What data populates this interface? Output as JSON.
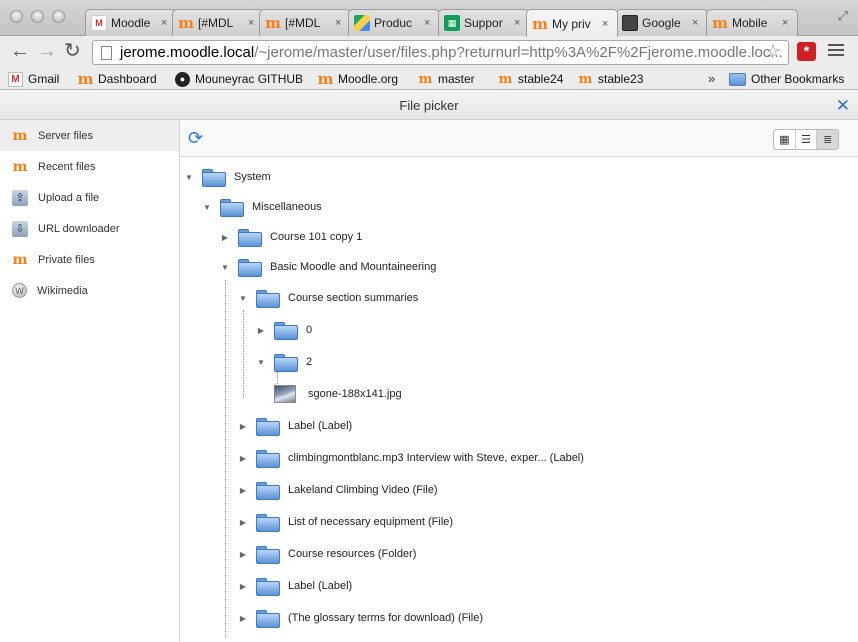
{
  "browser": {
    "tabs": [
      {
        "title": "Moodle",
        "favicon": "gmail-icon",
        "close": "×",
        "fav_text": "M"
      },
      {
        "title": "[#MDL",
        "favicon": "moodle-icon",
        "close": "×",
        "fav_text": "m"
      },
      {
        "title": "[#MDL",
        "favicon": "moodle-icon",
        "close": "×",
        "fav_text": "m"
      },
      {
        "title": "Produc",
        "favicon": "drive-icon",
        "close": "×",
        "fav_text": ""
      },
      {
        "title": "Suppor",
        "favicon": "sheets-icon",
        "close": "×",
        "fav_text": "▦"
      },
      {
        "title": "My priv",
        "favicon": "moodle-icon",
        "close": "×",
        "fav_text": "m"
      },
      {
        "title": "Google",
        "favicon": "google-icon",
        "close": "×",
        "fav_text": ""
      },
      {
        "title": "Mobile",
        "favicon": "moodle-icon",
        "close": "×",
        "fav_text": "m"
      }
    ],
    "url_host": "jerome.moodle.local",
    "url_path": "/~jerome/master/user/files.php?returnurl=http%3A%2F%2Fjerome.moodle.loc...",
    "bookmarks": [
      {
        "label": "Gmail",
        "icon": "gmail-icon",
        "glyph": "M"
      },
      {
        "label": "Dashboard",
        "icon": "moodle-icon",
        "glyph": "m"
      },
      {
        "label": "Mouneyrac GITHUB",
        "icon": "github-icon",
        "glyph": "●"
      },
      {
        "label": "Moodle.org",
        "icon": "moodle-icon",
        "glyph": "m"
      },
      {
        "label": "master",
        "icon": "moodle-icon",
        "glyph": "m"
      },
      {
        "label": "stable24",
        "icon": "moodle-icon",
        "glyph": "m"
      },
      {
        "label": "stable23",
        "icon": "moodle-icon",
        "glyph": "m"
      }
    ],
    "bookmarks_overflow": "»",
    "other_bookmarks": "Other Bookmarks"
  },
  "dialog": {
    "title": "File picker",
    "close_glyph": "✕"
  },
  "repositories": [
    {
      "label": "Server files",
      "icon": "moodle-icon",
      "glyph": "m",
      "active": true
    },
    {
      "label": "Recent files",
      "icon": "moodle-icon",
      "glyph": "m",
      "active": false
    },
    {
      "label": "Upload a file",
      "icon": "upload-icon",
      "glyph": "⇪",
      "active": false
    },
    {
      "label": "URL downloader",
      "icon": "url-download-icon",
      "glyph": "⇩",
      "active": false
    },
    {
      "label": "Private files",
      "icon": "moodle-icon",
      "glyph": "m",
      "active": false
    },
    {
      "label": "Wikimedia",
      "icon": "wikimedia-icon",
      "glyph": "W",
      "active": false
    }
  ],
  "tree": [
    {
      "label": "System",
      "depth": 0,
      "expanded": true,
      "type": "folder"
    },
    {
      "label": "Miscellaneous",
      "depth": 1,
      "expanded": true,
      "type": "folder"
    },
    {
      "label": "Course 101 copy 1",
      "depth": 2,
      "expanded": false,
      "type": "folder"
    },
    {
      "label": "Basic Moodle and Mountaineering",
      "depth": 2,
      "expanded": true,
      "type": "folder"
    },
    {
      "label": "Course section summaries",
      "depth": 3,
      "expanded": true,
      "type": "folder"
    },
    {
      "label": "0",
      "depth": 4,
      "expanded": false,
      "type": "folder"
    },
    {
      "label": "2",
      "depth": 4,
      "expanded": true,
      "type": "folder"
    },
    {
      "label": "sgone-188x141.jpg",
      "depth": 5,
      "expanded": false,
      "type": "file"
    },
    {
      "label": "Label (Label)",
      "depth": 3,
      "expanded": false,
      "type": "folder"
    },
    {
      "label": "climbingmontblanc.mp3 Interview with Steve, exper... (Label)",
      "depth": 3,
      "expanded": false,
      "type": "folder"
    },
    {
      "label": "Lakeland Climbing Video (File)",
      "depth": 3,
      "expanded": false,
      "type": "folder"
    },
    {
      "label": "List of necessary equipment (File)",
      "depth": 3,
      "expanded": false,
      "type": "folder"
    },
    {
      "label": "Course resources (Folder)",
      "depth": 3,
      "expanded": false,
      "type": "folder"
    },
    {
      "label": "Label (Label)",
      "depth": 3,
      "expanded": false,
      "type": "folder"
    },
    {
      "label": "(The glossary terms for download) (File)",
      "depth": 3,
      "expanded": false,
      "type": "folder"
    }
  ],
  "colors": {
    "moodle_orange": "#f98012",
    "link_blue": "#2c73d2",
    "folder_blue": "#5a93d8"
  }
}
